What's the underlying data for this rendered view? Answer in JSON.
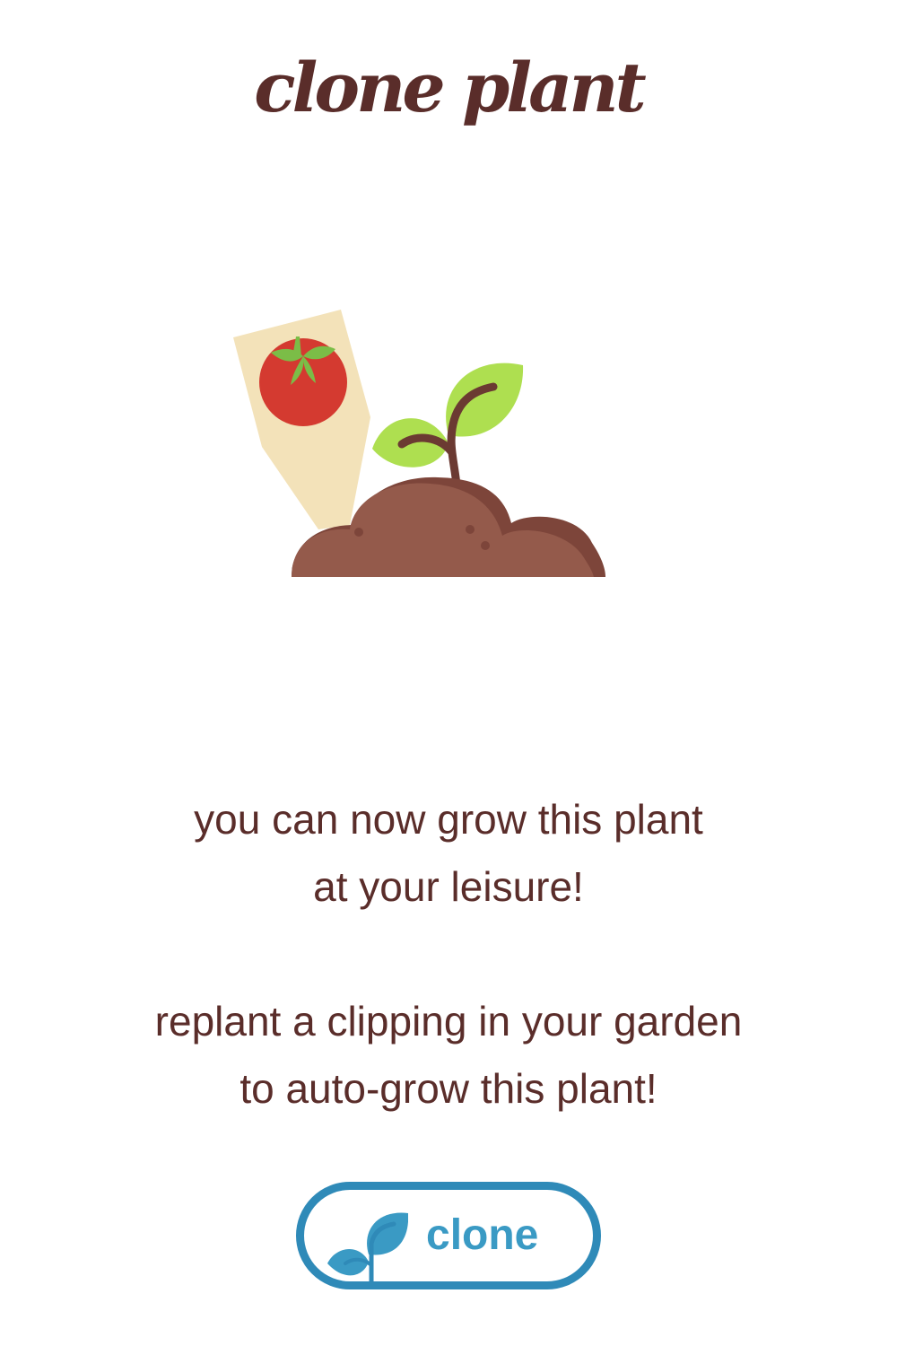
{
  "header": {
    "title": "clone plant"
  },
  "illustration": {
    "icon": "tomato-seedling-icon",
    "colors": {
      "tag": "#f3e2b9",
      "tomato": "#d43a30",
      "tomato_leaves": "#7bbd47",
      "sprout_leaves": "#aedf50",
      "stem": "#6b3a32",
      "soil": "#945a4b",
      "soil_shadow": "#7d453a"
    }
  },
  "message": {
    "line1": "you can now grow this plant",
    "line2": "at your leisure!",
    "line3": "replant a clipping in your garden",
    "line4": "to auto-grow this plant!"
  },
  "clone_button": {
    "label": "clone",
    "icon": "sprout-icon",
    "color": "#2f8ab8"
  }
}
